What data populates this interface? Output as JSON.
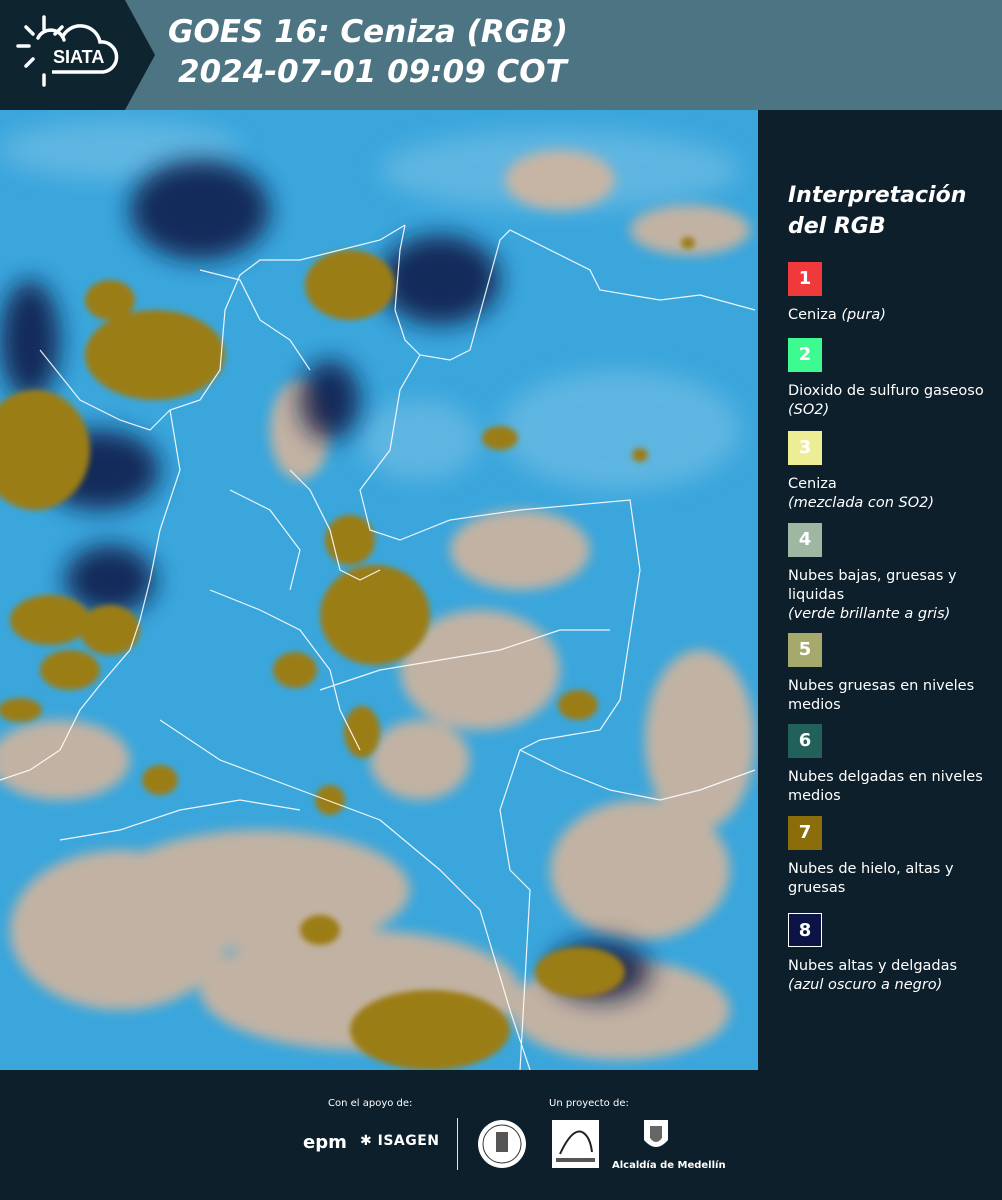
{
  "header": {
    "logo_text": "SIATA",
    "title_line1": "GOES 16: Ceniza (RGB)",
    "title_line2": "2024-07-01 09:09 COT"
  },
  "legend": {
    "title_line1": "Interpretación",
    "title_line2": "del RGB",
    "items": [
      {
        "number": "1",
        "color": "#f0393b",
        "text": "Ceniza ",
        "text_italic": "(pura)"
      },
      {
        "number": "2",
        "color": "#3dfa91",
        "text": "Dioxido de sulfuro gaseoso ",
        "text_italic": "(SO2)"
      },
      {
        "number": "3",
        "color": "#eded96",
        "text": "Ceniza",
        "text_italic": "(mezclada con SO2)"
      },
      {
        "number": "4",
        "color": "#9db7a3",
        "text": "Nubes bajas, gruesas y liquidas",
        "text_italic": "(verde brillante a gris)"
      },
      {
        "number": "5",
        "color": "#a7a96c",
        "text": "Nubes gruesas en niveles medios",
        "text_italic": ""
      },
      {
        "number": "6",
        "color": "#22605a",
        "text": "Nubes delgadas en niveles medios",
        "text_italic": ""
      },
      {
        "number": "7",
        "color": "#8c6d0c",
        "text": "Nubes de hielo, altas y gruesas",
        "text_italic": ""
      },
      {
        "number": "8",
        "color": "#0b1445",
        "text": "Nubes altas y delgadas",
        "text_italic": "(azul oscuro a negro)"
      }
    ]
  },
  "footer": {
    "support_label": "Con el apoyo de:",
    "project_label": "Un proyecto de:",
    "sponsors": [
      "epm",
      "ISAGEN"
    ],
    "partners": [
      "Área Metropolitana Valle de Aburrá",
      "Alcaldía de Medellín"
    ],
    "medellin_text": "Alcaldía de Medellín"
  },
  "colors": {
    "header_bg": "#4d7482",
    "panel_bg": "#0d1f2a",
    "map_sky": "#3aa6dc",
    "cloud_ice": "#8c6d0c",
    "cloud_thin": "#0b1445"
  }
}
